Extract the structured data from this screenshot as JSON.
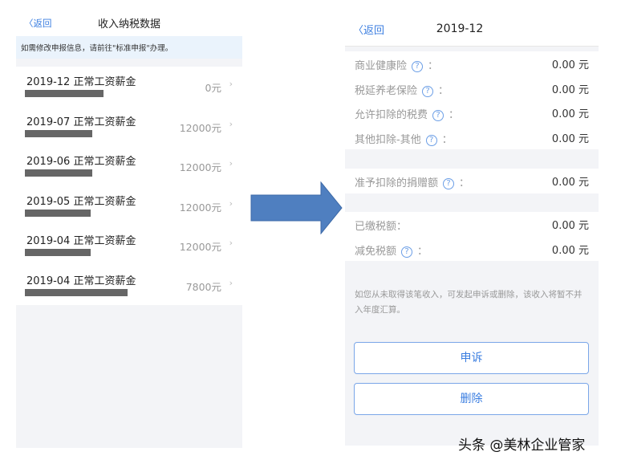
{
  "left": {
    "back": "〈返回",
    "title": "收入纳税数据",
    "notice": "如需修改申报信息，请前往\"标准申报\"办理。",
    "items": [
      {
        "name": "2019-12 正常工资薪金",
        "amount": "0元"
      },
      {
        "name": "2019-07 正常工资薪金",
        "amount": "12000元"
      },
      {
        "name": "2019-06 正常工资薪金",
        "amount": "12000元"
      },
      {
        "name": "2019-05 正常工资薪金",
        "amount": "12000元"
      },
      {
        "name": "2019-04 正常工资薪金",
        "amount": "12000元"
      },
      {
        "name": "2019-04 正常工资薪金",
        "amount": "7800元"
      }
    ]
  },
  "arrow_color": "#4f7fc0",
  "right": {
    "back": "〈返回",
    "title": "2019-12",
    "group1": [
      {
        "label": "商业健康险",
        "value": "0.00 元"
      },
      {
        "label": "税延养老保险",
        "value": "0.00 元"
      },
      {
        "label": "允许扣除的税费",
        "value": "0.00 元"
      },
      {
        "label": "其他扣除-其他",
        "value": "0.00 元"
      }
    ],
    "group2": [
      {
        "label": "准予扣除的捐赠额",
        "value": "0.00 元"
      }
    ],
    "group3": [
      {
        "label": "已缴税额",
        "value": "0.00 元",
        "help": false
      },
      {
        "label": "减免税额",
        "value": "0.00 元",
        "help": true
      }
    ],
    "note": "如您从未取得该笔收入，可发起申诉或删除，该收入将暂不并入年度汇算。",
    "appeal": "申诉",
    "delete": "删除"
  },
  "watermark": "头条 @美林企业管家"
}
